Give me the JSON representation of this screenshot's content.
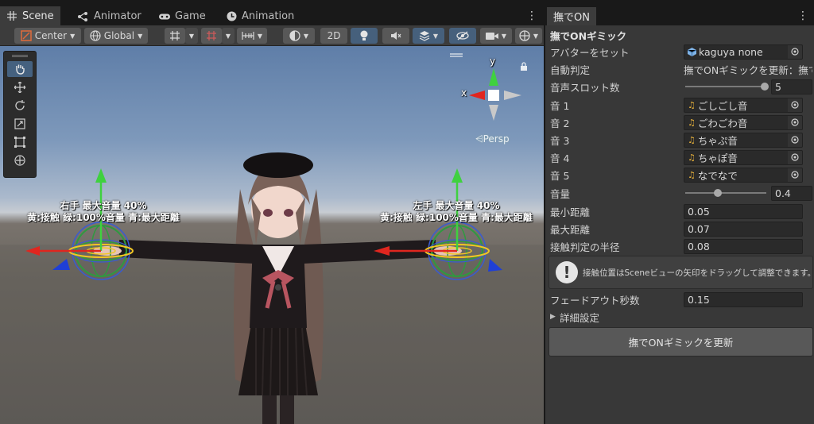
{
  "scene_tabs": [
    {
      "label": "Scene"
    },
    {
      "label": "Animator"
    },
    {
      "label": "Game"
    },
    {
      "label": "Animation"
    }
  ],
  "toolbar": {
    "pivot_label": "Center",
    "space_label": "Global",
    "mode_2d_label": "2D"
  },
  "viewport": {
    "persp_label": "Persp",
    "axis_y": "y",
    "axis_x": "x",
    "right_hand_label_line1": "右手  最大音量 40%",
    "right_hand_label_line2": "黄:接触  緑:100%音量  青:最大距離",
    "left_hand_label_line1": "左手  最大音量 40%",
    "left_hand_label_line2": "黄:接触  緑:100%音量  青:最大距離"
  },
  "inspector": {
    "tab_label": "撫でON",
    "section_title": "撫でONギミック",
    "avatar": {
      "label": "アバターをセット",
      "value": "kaguya none"
    },
    "auto_detect": {
      "label": "自動判定",
      "value": "撫でONギミックを更新：撫でO"
    },
    "slot_count": {
      "label": "音声スロット数",
      "value": "5",
      "fraction": 1.0
    },
    "sounds": [
      {
        "label": "音 1",
        "value": "ごしごし音"
      },
      {
        "label": "音 2",
        "value": "ごわごわ音"
      },
      {
        "label": "音 3",
        "value": "ちゃぷ音"
      },
      {
        "label": "音 4",
        "value": "ちゃぽ音"
      },
      {
        "label": "音 5",
        "value": "なでなで"
      }
    ],
    "volume": {
      "label": "音量",
      "value": "0.4",
      "fraction": 0.4
    },
    "min_distance": {
      "label": "最小距離",
      "value": "0.05"
    },
    "max_distance": {
      "label": "最大距離",
      "value": "0.07"
    },
    "contact_radius": {
      "label": "接触判定の半径",
      "value": "0.08"
    },
    "help_text": "接触位置はSceneビューの矢印をドラッグして調整できます。",
    "fadeout": {
      "label": "フェードアウト秒数",
      "value": "0.15"
    },
    "advanced_label": "詳細設定",
    "update_button": "撫でONギミックを更新"
  },
  "colors": {
    "accent_blue": "#46607c",
    "sound_icon": "#e8b23c",
    "gizmo_green": "#3fd13f",
    "gizmo_red": "#e0261f",
    "gizmo_blue": "#1f3fd6",
    "gizmo_yellow": "#f2c623"
  }
}
